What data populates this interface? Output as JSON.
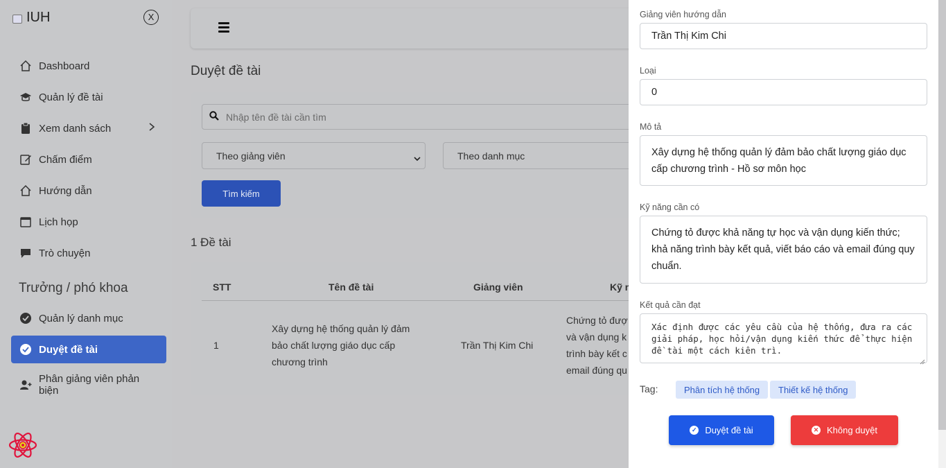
{
  "brand": {
    "name": "IUH",
    "close_label": "X"
  },
  "sidebar": {
    "items": [
      {
        "label": "Dashboard",
        "icon": "home-icon"
      },
      {
        "label": "Quản lý đề tài",
        "icon": "graduation-cap-icon"
      },
      {
        "label": "Xem danh sách",
        "icon": "clipboard-icon"
      },
      {
        "label": "Chấm điểm",
        "icon": "edit-icon"
      },
      {
        "label": "Hướng dẫn",
        "icon": "home-icon"
      },
      {
        "label": "Lịch họp",
        "icon": "calendar-icon"
      },
      {
        "label": "Trò chuyện",
        "icon": "chat-icon"
      }
    ],
    "section_title": "Trưởng / phó khoa",
    "section_items": [
      {
        "label": "Quản lý danh mục",
        "icon": "check-circle-icon"
      },
      {
        "label": "Duyệt đề tài",
        "icon": "check-circle-icon",
        "active": true
      },
      {
        "label": "Phân giảng viên phản biện",
        "icon": "user-plus-icon"
      }
    ]
  },
  "main": {
    "page_title": "Duyệt đề tài",
    "search": {
      "placeholder": "Nhập tên đề tài cần tìm",
      "filter_lecturer": "Theo giảng viên",
      "filter_category": "Theo danh mục",
      "button_label": "Tìm kiếm"
    },
    "count_label": "1 Đề tài",
    "table": {
      "headers": [
        "STT",
        "Tên đề tài",
        "Giảng viên",
        "Kỹ n"
      ],
      "rows": [
        {
          "stt": "1",
          "title": "Xây dựng hệ thống quản lý đảm bảo chất lượng giáo dục cấp chương trình",
          "lecturer": "Trần Thị Kim Chi",
          "skills": "Chứng tỏ đượ và vận dụng k trình bày kết c email đúng qu"
        }
      ]
    }
  },
  "panel": {
    "advisor_label": "Giảng viên hướng dẫn",
    "advisor_value": "Trần Thị Kim Chi",
    "type_label": "Loại",
    "type_value": "0",
    "description_label": "Mô tả",
    "description_value": "Xây dựng hệ thống quản lý đảm bảo chất lượng giáo dục cấp chương trình - Hồ sơ môn học",
    "skills_label": "Kỹ năng cần có",
    "skills_value": "Chứng tỏ được khả năng tự học và vận dụng kiến thức; khả năng trình bày kết quả, viết báo cáo và email đúng quy chuẩn.",
    "result_label": "Kết quả cần đạt",
    "result_value": "Xác định được các yêu cầu của hệ thống, đưa ra các giải pháp, học hỏi/vận dụng kiến thức để thực hiện đề tài một cách kiên trì.",
    "tag_label": "Tag:",
    "tags": [
      "Phân tích hệ thống",
      "Thiết kế hệ thống"
    ],
    "approve_label": "Duyệt đề tài",
    "reject_label": "Không duyệt"
  },
  "colors": {
    "accent": "#1e59e6",
    "danger": "#ed3c3c",
    "tag_bg": "#dbe6fb",
    "active_nav": "#3d66c7"
  }
}
